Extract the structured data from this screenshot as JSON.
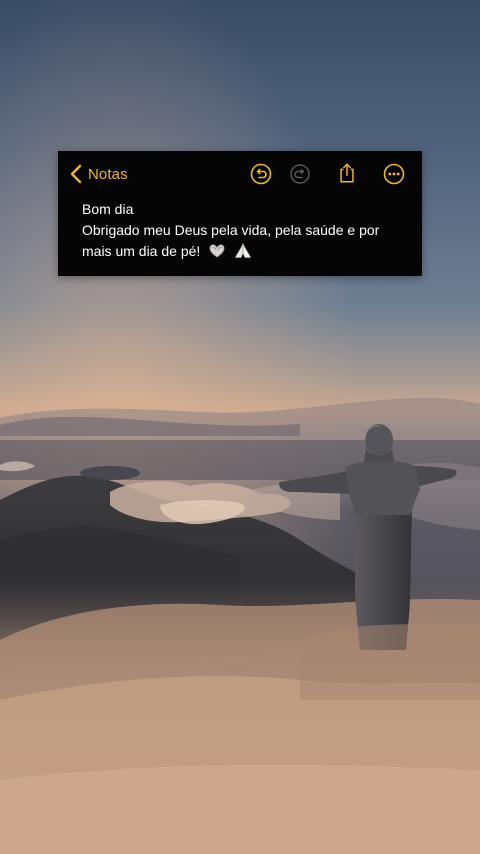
{
  "header": {
    "back_label": "Notas",
    "icons": [
      "chevron-left-icon",
      "undo-icon",
      "redo-icon",
      "share-icon",
      "more-icon"
    ]
  },
  "note": {
    "line1": "Bom dia",
    "line2": "Obrigado meu Deus pela vida, pela saúde e por",
    "line3": "mais um dia de pé!",
    "emojis": [
      "heart-hands-icon",
      "praying-hands-icon"
    ]
  },
  "colors": {
    "accent": "#f0b632",
    "card_bg": "#050505",
    "text": "#ffffff",
    "disabled_icon": "#5a5a5a"
  }
}
